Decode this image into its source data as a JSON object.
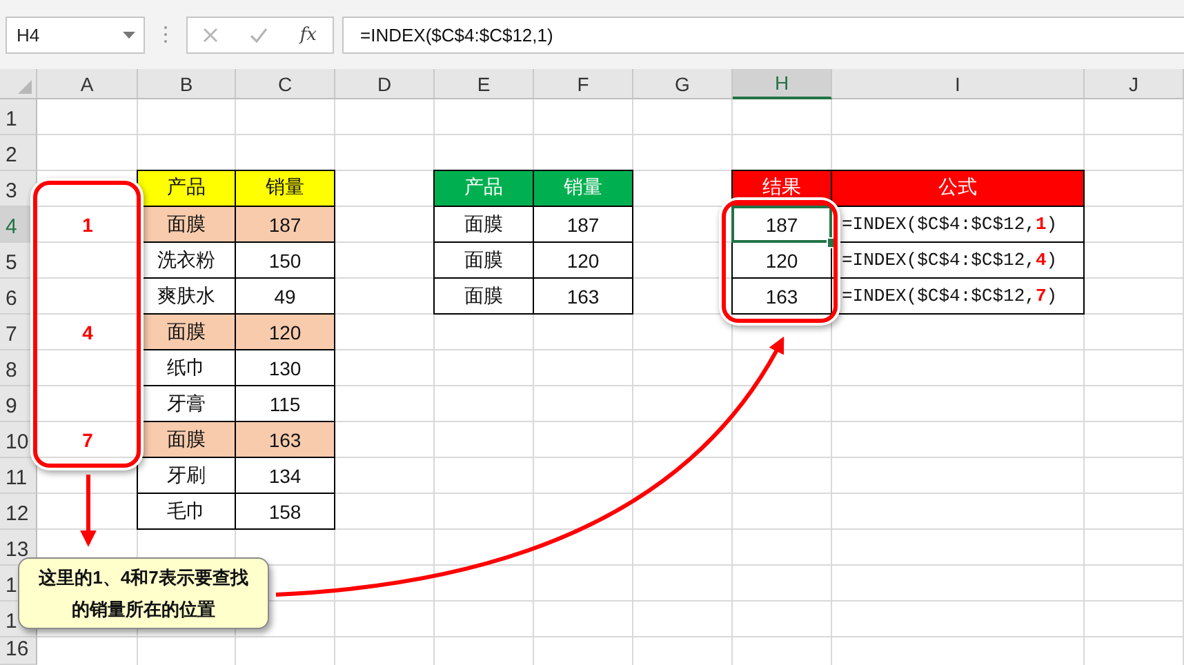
{
  "formula_bar": {
    "name_box": "H4",
    "function_label": "fx",
    "formula": "=INDEX($C$4:$C$12,1)"
  },
  "columns": [
    {
      "label": "A",
      "selected": false
    },
    {
      "label": "B",
      "selected": false
    },
    {
      "label": "C",
      "selected": false
    },
    {
      "label": "D",
      "selected": false
    },
    {
      "label": "E",
      "selected": false
    },
    {
      "label": "F",
      "selected": false
    },
    {
      "label": "G",
      "selected": false
    },
    {
      "label": "H",
      "selected": true
    },
    {
      "label": "I",
      "selected": false
    },
    {
      "label": "J",
      "selected": false
    }
  ],
  "rows": [
    {
      "label": "1",
      "selected": false
    },
    {
      "label": "2",
      "selected": false
    },
    {
      "label": "3",
      "selected": false,
      "cells": [
        {
          "kind": "empty"
        },
        {
          "kind": "header",
          "text": "产品",
          "color": "#ffff00",
          "selected": false
        },
        {
          "kind": "header",
          "text": "销量",
          "color": "#ffff00",
          "selected": false
        },
        {
          "kind": "empty"
        },
        {
          "kind": "header",
          "text": "产品",
          "color": "#00b050",
          "selected": false
        },
        {
          "kind": "header",
          "text": "销量",
          "color": "#00b050",
          "selected": false
        },
        {
          "kind": "empty"
        },
        {
          "kind": "header",
          "text": "结果",
          "color": "#ff0000",
          "selected": false
        },
        {
          "kind": "header",
          "text": "公式",
          "color": "#ff0000",
          "selected": false
        }
      ]
    },
    {
      "label": "4",
      "selected": true,
      "cells": [
        {
          "kind": "note",
          "text": "1",
          "selected": false
        },
        {
          "kind": "data",
          "text": "面膜",
          "color": "#f8cbad",
          "selected": false
        },
        {
          "kind": "data",
          "text": "187",
          "color": "#f8cbad",
          "selected": false
        },
        {
          "kind": "empty"
        },
        {
          "kind": "data",
          "text": "面膜",
          "selected": false
        },
        {
          "kind": "data",
          "text": "187",
          "selected": false
        },
        {
          "kind": "empty"
        },
        {
          "kind": "data",
          "text": "187",
          "selected": true
        },
        {
          "kind": "formula",
          "text": "=INDEX($C$4:$C$12,**1**)",
          "selected": false
        }
      ]
    },
    {
      "label": "5",
      "selected": false,
      "cells": [
        {
          "kind": "empty"
        },
        {
          "kind": "data",
          "text": "洗衣粉",
          "selected": false
        },
        {
          "kind": "data",
          "text": "150",
          "selected": false
        },
        {
          "kind": "empty"
        },
        {
          "kind": "data",
          "text": "面膜",
          "selected": false
        },
        {
          "kind": "data",
          "text": "120",
          "selected": false
        },
        {
          "kind": "empty"
        },
        {
          "kind": "data",
          "text": "120",
          "selected": false
        },
        {
          "kind": "formula",
          "text": "=INDEX($C$4:$C$12,**4**)",
          "selected": false
        }
      ]
    },
    {
      "label": "6",
      "selected": false,
      "cells": [
        {
          "kind": "empty"
        },
        {
          "kind": "data",
          "text": "爽肤水",
          "selected": false
        },
        {
          "kind": "data",
          "text": "49",
          "selected": false
        },
        {
          "kind": "empty"
        },
        {
          "kind": "data",
          "text": "面膜",
          "selected": false
        },
        {
          "kind": "data",
          "text": "163",
          "selected": false
        },
        {
          "kind": "empty"
        },
        {
          "kind": "data",
          "text": "163",
          "selected": false
        },
        {
          "kind": "formula",
          "text": "=INDEX($C$4:$C$12,**7**)",
          "selected": false
        }
      ]
    },
    {
      "label": "7",
      "selected": false,
      "cells": [
        {
          "kind": "note",
          "text": "4",
          "selected": false
        },
        {
          "kind": "data",
          "text": "面膜",
          "color": "#f8cbad",
          "selected": false
        },
        {
          "kind": "data",
          "text": "120",
          "color": "#f8cbad",
          "selected": false
        }
      ]
    },
    {
      "label": "8",
      "selected": false,
      "cells": [
        {
          "kind": "empty"
        },
        {
          "kind": "data",
          "text": "纸巾",
          "selected": false
        },
        {
          "kind": "data",
          "text": "130",
          "selected": false
        }
      ]
    },
    {
      "label": "9",
      "selected": false,
      "cells": [
        {
          "kind": "empty"
        },
        {
          "kind": "data",
          "text": "牙膏",
          "selected": false
        },
        {
          "kind": "data",
          "text": "115",
          "selected": false
        }
      ]
    },
    {
      "label": "10",
      "selected": false,
      "cells": [
        {
          "kind": "note",
          "text": "7",
          "selected": false
        },
        {
          "kind": "data",
          "text": "面膜",
          "color": "#f8cbad",
          "selected": false
        },
        {
          "kind": "data",
          "text": "163",
          "color": "#f8cbad",
          "selected": false
        }
      ]
    },
    {
      "label": "11",
      "selected": false,
      "cells": [
        {
          "kind": "empty"
        },
        {
          "kind": "data",
          "text": "牙刷",
          "selected": false
        },
        {
          "kind": "data",
          "text": "134",
          "selected": false
        }
      ]
    },
    {
      "label": "12",
      "selected": false,
      "cells": [
        {
          "kind": "empty"
        },
        {
          "kind": "data",
          "text": "毛巾",
          "selected": false
        },
        {
          "kind": "data",
          "text": "158",
          "selected": false
        }
      ]
    },
    {
      "label": "13",
      "selected": false
    },
    {
      "label": "1",
      "selected": false
    },
    {
      "label": "1",
      "selected": false
    },
    {
      "label": "16",
      "selected": false
    }
  ],
  "callout": {
    "text": "这里的1、4和7表示要查找的销量所在的位置"
  }
}
